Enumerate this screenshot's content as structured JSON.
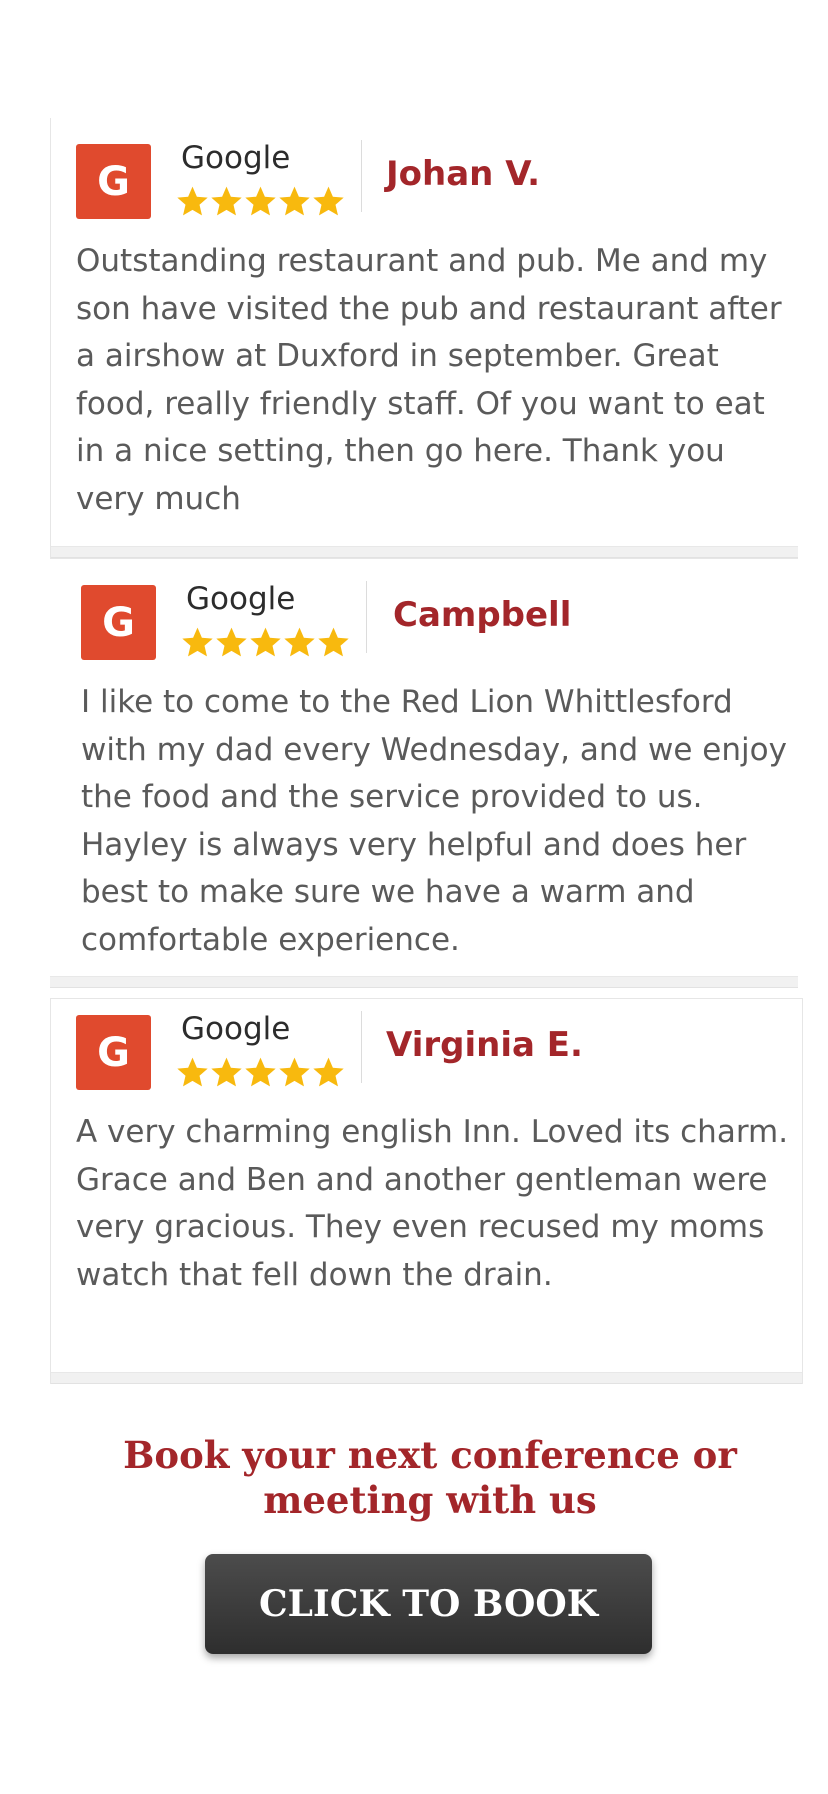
{
  "reviews": [
    {
      "source": "Google",
      "logo_letter": "G",
      "author": "Johan V.",
      "rating": 5,
      "text": "Outstanding restaurant and pub. Me and my son have visited the pub and restaurant after a airshow at Duxford in september. Great food, really friendly staff. Of you want to eat in a nice setting, then go here. Thank you very much"
    },
    {
      "source": "Google",
      "logo_letter": "G",
      "author": "Campbell",
      "rating": 5,
      "text": "I like to come to the Red Lion Whittlesford with my dad every Wednesday, and we enjoy the food and the service provided to us. Hayley is always very helpful and does her best to make sure we have a warm and comfortable experience."
    },
    {
      "source": "Google",
      "logo_letter": "G",
      "author": "Virginia E.",
      "rating": 5,
      "text": "A very charming english Inn. Loved its charm. Grace and Ben and another gentleman were very gracious. They even recused my moms watch that fell down the drain."
    }
  ],
  "cta": {
    "heading": "Book your next conference or meeting with us",
    "button_label": "CLICK TO BOOK"
  },
  "colors": {
    "google_logo": "#e04a2e",
    "author": "#a3262a",
    "star": "#f8b90e",
    "button": "#3b3b3b"
  },
  "icons": {
    "logo": "google-g-icon",
    "rating": "star-icon"
  }
}
